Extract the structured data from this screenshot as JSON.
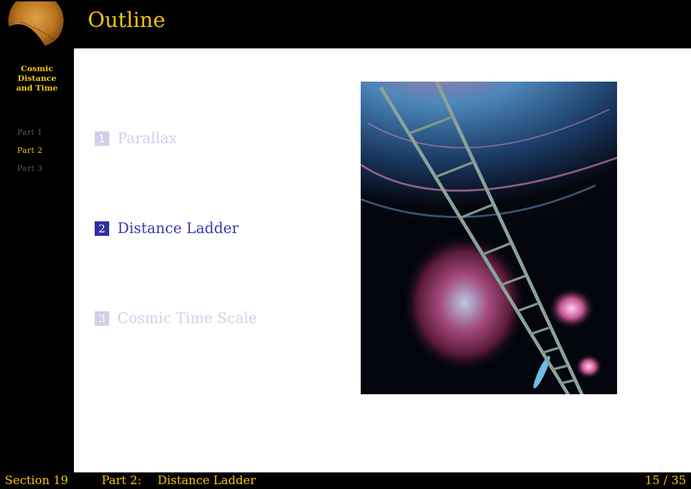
{
  "sidebar": {
    "title_lines": [
      "Cosmic",
      "Distance",
      "and Time"
    ],
    "items": [
      {
        "label": "Part 1",
        "active": false
      },
      {
        "label": "Part 2",
        "active": true
      },
      {
        "label": "Part 3",
        "active": false
      }
    ]
  },
  "header": {
    "title": "Outline"
  },
  "outline": {
    "items": [
      {
        "number": "1",
        "label": "Parallax",
        "current": false
      },
      {
        "number": "2",
        "label": "Distance Ladder",
        "current": true
      },
      {
        "number": "3",
        "label": "Cosmic Time Scale",
        "current": false
      }
    ]
  },
  "footer": {
    "section": "Section 19",
    "part": "Part 2:",
    "part_title": "Distance Ladder",
    "page": "15 / 35"
  },
  "colors": {
    "accent": "#f1c40f",
    "current": "#2f2f9f",
    "dim": "#d0d0ea"
  }
}
